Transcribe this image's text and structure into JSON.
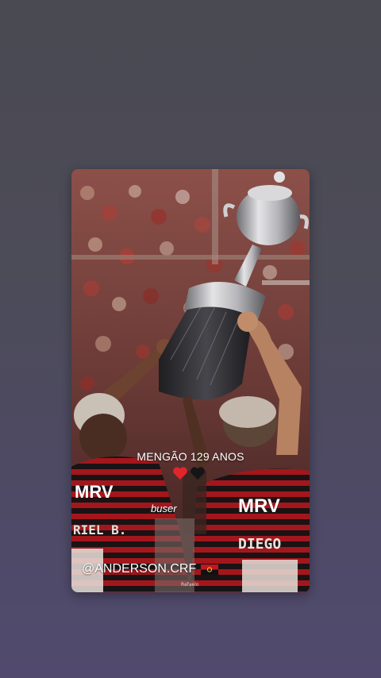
{
  "story": {
    "caption": "MENGÃO 129 ANOS",
    "hearts": [
      "red-heart-icon",
      "black-heart-icon"
    ],
    "mention": "@ANDERSON.CRF",
    "flag_icon": "flag-icon",
    "credit": "Rafaelo"
  },
  "jerseys": {
    "left_sponsor": "MRV",
    "left_name": "RIEL B.",
    "left_chest": "buser",
    "right_sponsor": "MRV",
    "right_name": "DIEGO"
  },
  "colors": {
    "red": "#c4161c",
    "black": "#111111",
    "background_top": "#4a4a52",
    "background_bottom": "#514a6e"
  }
}
